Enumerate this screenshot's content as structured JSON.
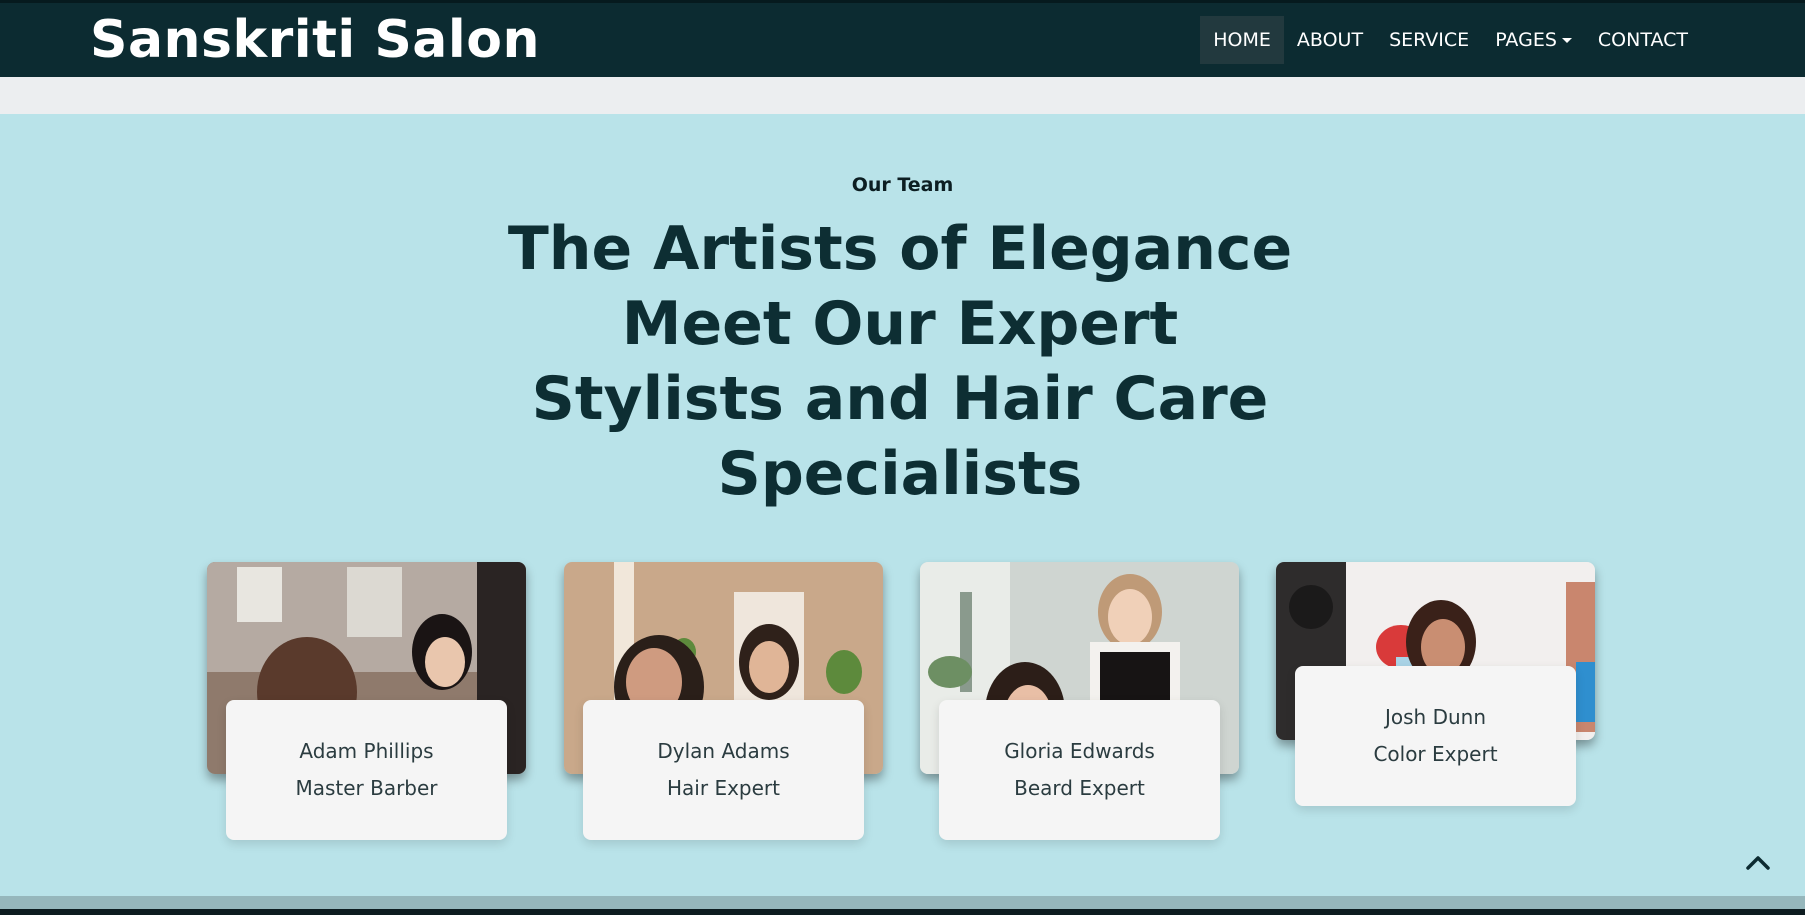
{
  "brand": {
    "name": "Sanskriti Salon"
  },
  "nav": {
    "items": [
      {
        "label": "HOME"
      },
      {
        "label": "ABOUT"
      },
      {
        "label": "SERVICE"
      },
      {
        "label": "PAGES"
      },
      {
        "label": "CONTACT"
      }
    ]
  },
  "team": {
    "eyebrow": "Our Team",
    "heading_lines": [
      "The Artists of Elegance",
      "Meet Our Expert",
      "Stylists and Hair Care",
      "Specialists"
    ],
    "members": [
      {
        "name": "Adam Phillips",
        "role": "Master Barber"
      },
      {
        "name": "Dylan Adams",
        "role": "Hair Expert"
      },
      {
        "name": "Gloria Edwards",
        "role": "Beard Expert"
      },
      {
        "name": "Josh Dunn",
        "role": "Color Expert"
      }
    ]
  },
  "colors": {
    "navbar": "#0c2b31",
    "section_bg": "#b9e3e9",
    "heading": "#0d2e33",
    "card_bg": "#f5f5f5"
  },
  "icons": {
    "scroll_top": "chevron-up-icon",
    "dropdown": "caret-down-icon"
  }
}
